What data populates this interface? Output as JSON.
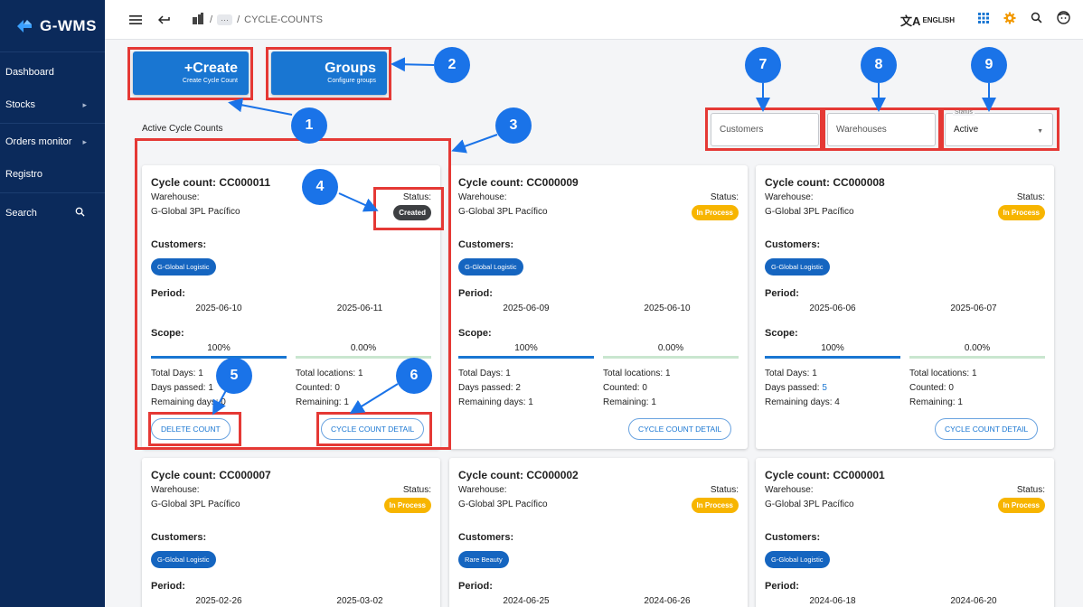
{
  "app": {
    "logo_text": "G-WMS"
  },
  "sidebar": {
    "items": [
      {
        "label": "Dashboard"
      },
      {
        "label": "Stocks"
      },
      {
        "label": "Orders monitor"
      },
      {
        "label": "Registro"
      },
      {
        "label": "Search"
      }
    ]
  },
  "topbar": {
    "breadcrumb_sep1": "/",
    "breadcrumb_dots": "···",
    "breadcrumb_sep2": "/",
    "breadcrumb_current": "CYCLE-COUNTS",
    "language": "ENGLISH"
  },
  "actions": {
    "create_plus": "+",
    "create_title": "Create",
    "create_sub": "Create Cycle Count",
    "groups_title": "Groups",
    "groups_sub": "Configure groups"
  },
  "filters": {
    "customers_placeholder": "Customers",
    "warehouses_placeholder": "Warehouses",
    "status_legend": "Status",
    "status_value": "Active"
  },
  "section": {
    "title": "Active Cycle Counts"
  },
  "labels": {
    "warehouse": "Warehouse:",
    "status": "Status:",
    "customers": "Customers:",
    "period": "Period:",
    "scope": "Scope:",
    "total_days": "Total Days:",
    "days_passed": "Days passed:",
    "remaining_days": "Remaining days:",
    "total_locations": "Total locations:",
    "counted": "Counted:",
    "remaining": "Remaining:",
    "delete_count": "DELETE COUNT",
    "detail": "CYCLE COUNT DETAIL"
  },
  "cards": [
    {
      "title": "Cycle count: CC000011",
      "warehouse": "G-Global 3PL Pacífico",
      "status": "Created",
      "customer": "G-Global Logistic",
      "start": "2025-06-10",
      "end": "2025-06-11",
      "pct_days": "100%",
      "pct_loc": "0.00%",
      "days_fill": 1.0,
      "loc_fill": 0.0,
      "total_days": "1",
      "days_passed": "1",
      "remaining_days": "0",
      "total_locations": "1",
      "counted": "0",
      "remaining": "1"
    },
    {
      "title": "Cycle count: CC000009",
      "warehouse": "G-Global 3PL Pacífico",
      "status": "In Process",
      "customer": "G-Global Logistic",
      "start": "2025-06-09",
      "end": "2025-06-10",
      "pct_days": "100%",
      "pct_loc": "0.00%",
      "days_fill": 1.0,
      "loc_fill": 0.0,
      "total_days": "1",
      "days_passed": "2",
      "remaining_days": "1",
      "total_locations": "1",
      "counted": "0",
      "remaining": "1"
    },
    {
      "title": "Cycle count: CC000008",
      "warehouse": "G-Global 3PL Pacífico",
      "status": "In Process",
      "customer": "G-Global Logistic",
      "start": "2025-06-06",
      "end": "2025-06-07",
      "pct_days": "100%",
      "pct_loc": "0.00%",
      "days_fill": 1.0,
      "loc_fill": 0.0,
      "total_days": "1",
      "days_passed": "5",
      "remaining_days": "4",
      "total_locations": "1",
      "counted": "0",
      "remaining": "1"
    },
    {
      "title": "Cycle count: CC000007",
      "warehouse": "G-Global 3PL Pacífico",
      "status": "In Process",
      "customer": "G-Global Logistic",
      "start": "2025-02-26",
      "end": "2025-03-02"
    },
    {
      "title": "Cycle count: CC000002",
      "warehouse": "G-Global 3PL Pacífico",
      "status": "In Process",
      "customer": "Rare Beauty",
      "start": "2024-06-25",
      "end": "2024-06-26"
    },
    {
      "title": "Cycle count: CC000001",
      "warehouse": "G-Global 3PL Pacífico",
      "status": "In Process",
      "customer": "G-Global Logistic",
      "start": "2024-06-18",
      "end": "2024-06-20"
    }
  ],
  "annotations": [
    "1",
    "2",
    "3",
    "4",
    "5",
    "6",
    "7",
    "8",
    "9"
  ],
  "colors": {
    "sidebar": "#0b2a5b",
    "primary": "#1976d2",
    "annotation": "#1a73e8",
    "highlight": "#e53935",
    "in_process": "#f7b500",
    "created": "#3d3f42"
  }
}
